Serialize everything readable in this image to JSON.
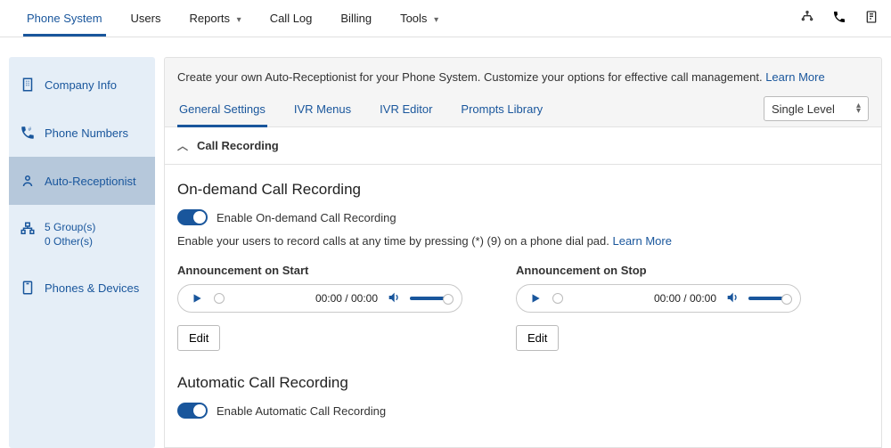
{
  "topnav": {
    "items": [
      {
        "label": "Phone System",
        "has_menu": false,
        "active": true
      },
      {
        "label": "Users",
        "has_menu": false
      },
      {
        "label": "Reports",
        "has_menu": true
      },
      {
        "label": "Call Log",
        "has_menu": false
      },
      {
        "label": "Billing",
        "has_menu": false
      },
      {
        "label": "Tools",
        "has_menu": true
      }
    ]
  },
  "sidebar": {
    "items": [
      {
        "label": "Company Info"
      },
      {
        "label": "Phone Numbers"
      },
      {
        "label": "Auto-Receptionist",
        "active": true
      },
      {
        "line1": "5 Group(s)",
        "line2": "0 Other(s)"
      },
      {
        "label": "Phones & Devices"
      }
    ]
  },
  "hero": {
    "blurb": "Create your own Auto-Receptionist for your Phone System. Customize your options for effective call management. ",
    "learn_more": "Learn More",
    "tabs": [
      {
        "label": "General Settings",
        "active": true
      },
      {
        "label": "IVR Menus"
      },
      {
        "label": "IVR Editor"
      },
      {
        "label": "Prompts Library"
      }
    ],
    "level_selected": "Single Level"
  },
  "section": {
    "title": "Call Recording"
  },
  "on_demand": {
    "heading": "On-demand Call Recording",
    "toggle_label": "Enable On-demand Call Recording",
    "helper": "Enable your users to record calls at any time by pressing (*) (9) on a phone dial pad. ",
    "helper_link": "Learn More",
    "start_label": "Announcement on Start",
    "stop_label": "Announcement on Stop",
    "time": "00:00 / 00:00",
    "edit_label": "Edit"
  },
  "automatic": {
    "heading": "Automatic Call Recording",
    "toggle_label": "Enable Automatic Call Recording"
  }
}
